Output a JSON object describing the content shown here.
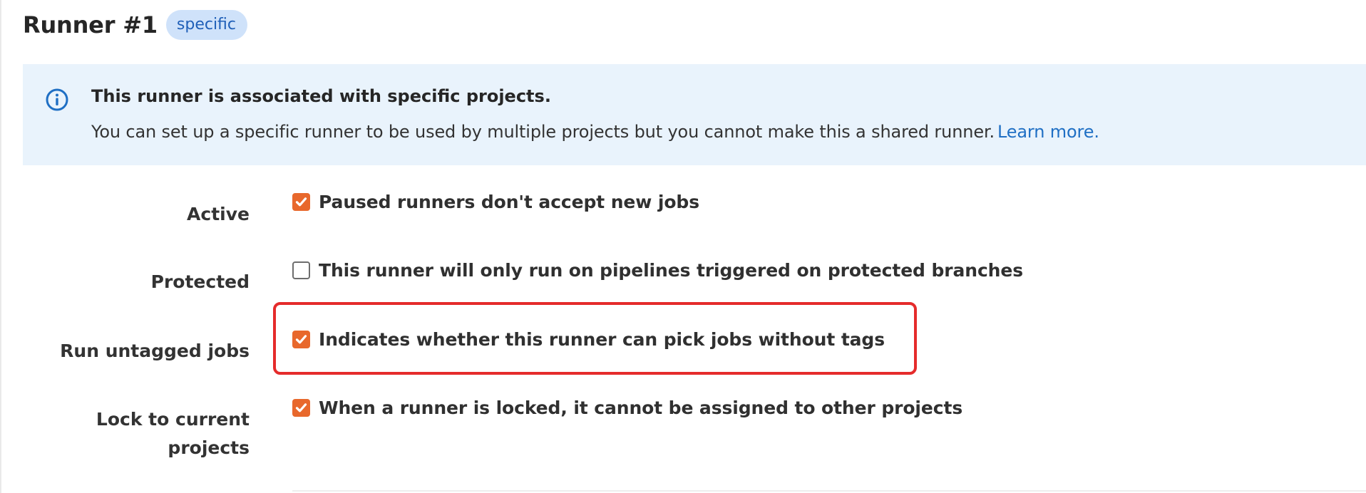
{
  "header": {
    "title": "Runner #1",
    "badge": "specific"
  },
  "alert": {
    "icon": "info-icon",
    "title": "This runner is associated with specific projects.",
    "body": "You can set up a specific runner to be used by multiple projects but you cannot make this a shared runner.",
    "link": "Learn more."
  },
  "settings": {
    "active": {
      "label": "Active",
      "checked": true,
      "description": "Paused runners don't accept new jobs"
    },
    "protected": {
      "label": "Protected",
      "checked": false,
      "description": "This runner will only run on pipelines triggered on protected branches"
    },
    "run_untagged": {
      "label": "Run untagged jobs",
      "checked": true,
      "description": "Indicates whether this runner can pick jobs without tags"
    },
    "locked": {
      "label_line1": "Lock to current",
      "label_line2": "projects",
      "checked": true,
      "description": "When a runner is locked, it cannot be assigned to other projects"
    }
  },
  "colors": {
    "checkbox_checked": "#e8682c",
    "alert_background": "#e9f3fc",
    "link": "#1f6fc4",
    "highlight_border": "#e52b2b",
    "badge_background": "#cfe2fa"
  }
}
